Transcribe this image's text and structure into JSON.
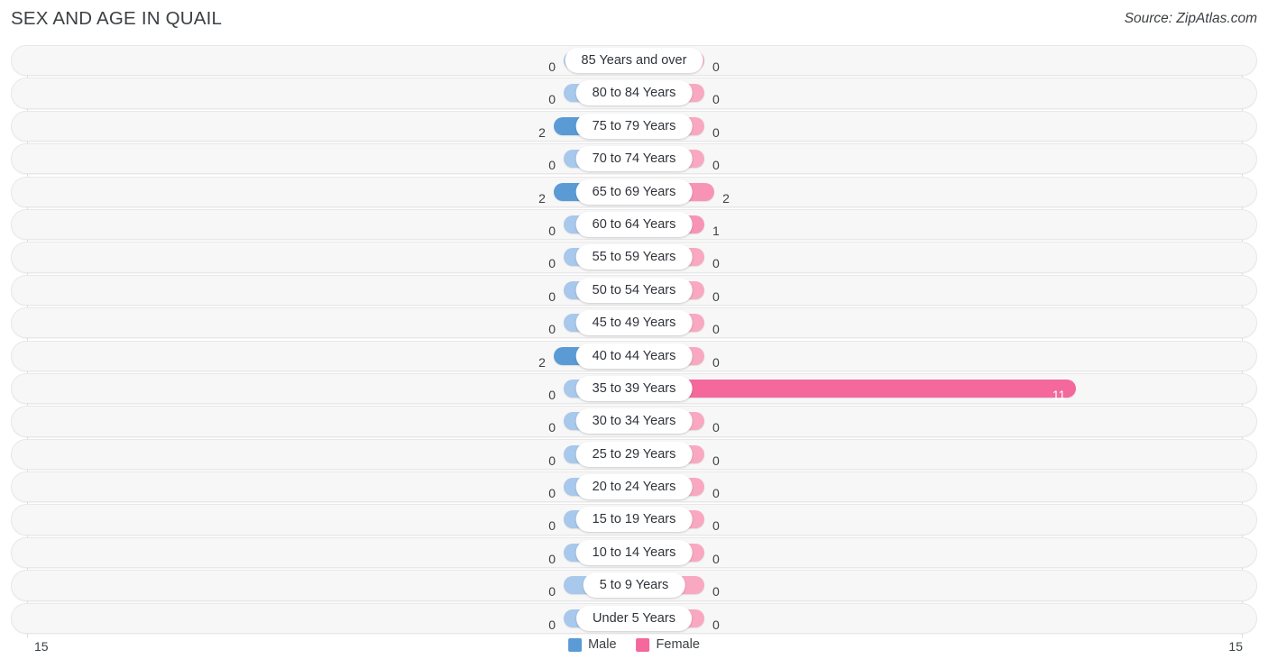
{
  "header": {
    "title": "SEX AND AGE IN QUAIL",
    "source": "Source: ZipAtlas.com"
  },
  "legend": {
    "male_label": "Male",
    "female_label": "Female",
    "male_color": "#5b9bd5",
    "female_color": "#f4689c"
  },
  "axis": {
    "left_max_label": "15",
    "right_max_label": "15",
    "max": 15
  },
  "colors": {
    "male_light": "#a8c8ec",
    "male_mid": "#8fb9e3",
    "male_dark": "#5b9bd5",
    "female_light": "#f9a8c2",
    "female_mid": "#f794b5",
    "female_dark": "#f4689c",
    "row_background": "#f7f7f7",
    "row_border": "#e8e8ea",
    "axis_line": "#e2e2e4",
    "text": "#3c4043"
  },
  "chart_data": {
    "type": "bar",
    "title": "SEX AND AGE IN QUAIL",
    "subtitle": "",
    "xlabel": "",
    "ylabel": "",
    "orientation": "horizontal-diverging",
    "legend_position": "bottom-center",
    "grid": false,
    "xlim": [
      15,
      15
    ],
    "categories": [
      "85 Years and over",
      "80 to 84 Years",
      "75 to 79 Years",
      "70 to 74 Years",
      "65 to 69 Years",
      "60 to 64 Years",
      "55 to 59 Years",
      "50 to 54 Years",
      "45 to 49 Years",
      "40 to 44 Years",
      "35 to 39 Years",
      "30 to 34 Years",
      "25 to 29 Years",
      "20 to 24 Years",
      "15 to 19 Years",
      "10 to 14 Years",
      "5 to 9 Years",
      "Under 5 Years"
    ],
    "series": [
      {
        "name": "Male",
        "color": "#5b9bd5",
        "values": [
          0,
          0,
          2,
          0,
          2,
          0,
          0,
          0,
          0,
          2,
          0,
          0,
          0,
          0,
          0,
          0,
          0,
          0
        ]
      },
      {
        "name": "Female",
        "color": "#f4689c",
        "values": [
          0,
          0,
          0,
          0,
          2,
          1,
          0,
          0,
          0,
          0,
          11,
          0,
          0,
          0,
          0,
          0,
          0,
          0
        ]
      }
    ]
  },
  "rows": [
    {
      "label": "85 Years and over",
      "male": "0",
      "female": "0"
    },
    {
      "label": "80 to 84 Years",
      "male": "0",
      "female": "0"
    },
    {
      "label": "75 to 79 Years",
      "male": "2",
      "female": "0"
    },
    {
      "label": "70 to 74 Years",
      "male": "0",
      "female": "0"
    },
    {
      "label": "65 to 69 Years",
      "male": "2",
      "female": "2"
    },
    {
      "label": "60 to 64 Years",
      "male": "0",
      "female": "1"
    },
    {
      "label": "55 to 59 Years",
      "male": "0",
      "female": "0"
    },
    {
      "label": "50 to 54 Years",
      "male": "0",
      "female": "0"
    },
    {
      "label": "45 to 49 Years",
      "male": "0",
      "female": "0"
    },
    {
      "label": "40 to 44 Years",
      "male": "2",
      "female": "0"
    },
    {
      "label": "35 to 39 Years",
      "male": "0",
      "female": "11"
    },
    {
      "label": "30 to 34 Years",
      "male": "0",
      "female": "0"
    },
    {
      "label": "25 to 29 Years",
      "male": "0",
      "female": "0"
    },
    {
      "label": "20 to 24 Years",
      "male": "0",
      "female": "0"
    },
    {
      "label": "15 to 19 Years",
      "male": "0",
      "female": "0"
    },
    {
      "label": "10 to 14 Years",
      "male": "0",
      "female": "0"
    },
    {
      "label": "5 to 9 Years",
      "male": "0",
      "female": "0"
    },
    {
      "label": "Under 5 Years",
      "male": "0",
      "female": "0"
    }
  ]
}
